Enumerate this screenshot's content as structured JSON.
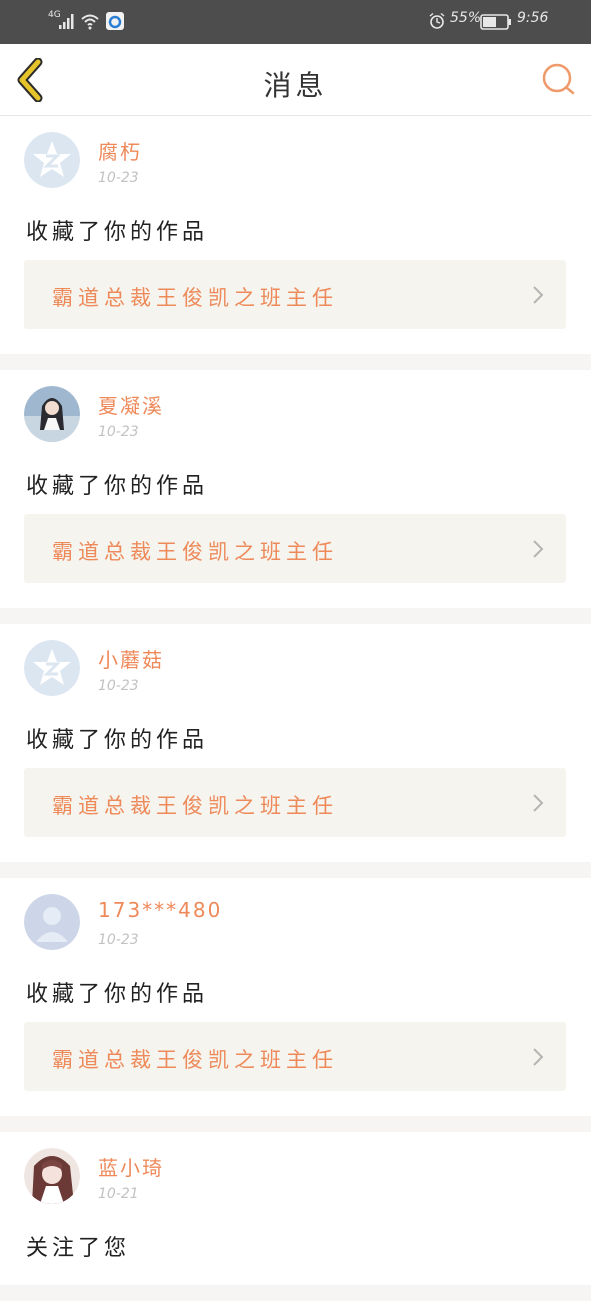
{
  "status_bar": {
    "network": "4G",
    "battery": "55%",
    "time": "9:56",
    "icons": [
      "signal-icon",
      "wifi-icon",
      "app-icon",
      "alarm-icon",
      "battery-icon"
    ]
  },
  "header": {
    "title": "消息",
    "back_icon": "chevron-left-icon",
    "search_icon": "search-icon"
  },
  "colors": {
    "accent": "#ee8a5a",
    "back_arrow": "#e6c42a",
    "card_bg": "#f5f4ee",
    "status_bar_bg": "#4d4d4d"
  },
  "messages": [
    {
      "username": "腐朽",
      "date": "10-23",
      "action": "收藏了你的作品",
      "work_title": "霸道总裁王俊凯之班主任",
      "avatar": "qzone-default-avatar"
    },
    {
      "username": "夏凝溪",
      "date": "10-23",
      "action": "收藏了你的作品",
      "work_title": "霸道总裁王俊凯之班主任",
      "avatar": "photo-avatar"
    },
    {
      "username": "小蘑菇",
      "date": "10-23",
      "action": "收藏了你的作品",
      "work_title": "霸道总裁王俊凯之班主任",
      "avatar": "qzone-default-avatar"
    },
    {
      "username": "173***480",
      "date": "10-23",
      "action": "收藏了你的作品",
      "work_title": "霸道总裁王俊凯之班主任",
      "avatar": "default-person-avatar"
    },
    {
      "username": "蓝小琦",
      "date": "10-21",
      "action": "关注了您",
      "avatar": "anime-avatar"
    }
  ]
}
